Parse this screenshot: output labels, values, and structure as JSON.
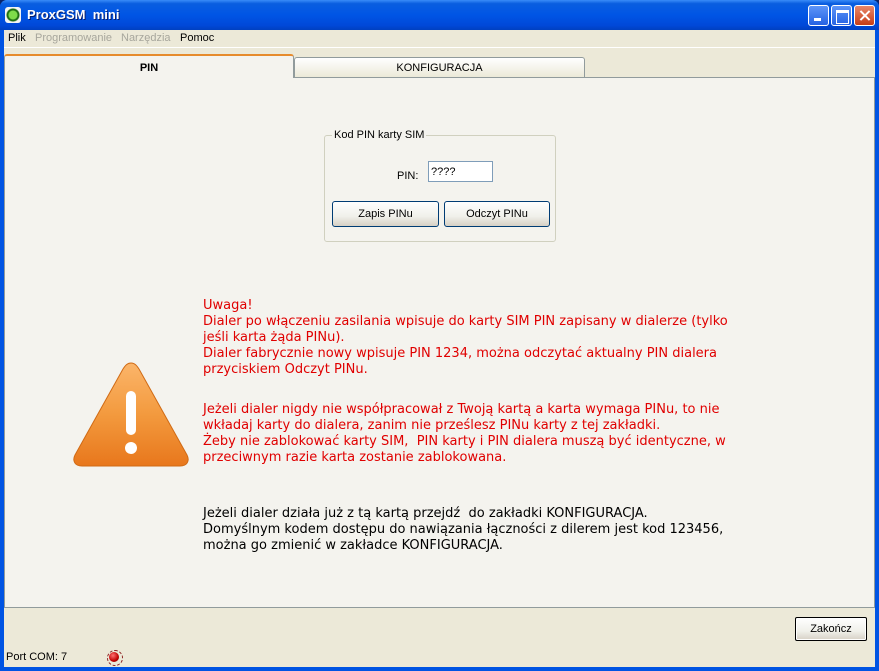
{
  "window": {
    "title": "ProxGSM  mini"
  },
  "menu": {
    "items": [
      {
        "label": "Plik",
        "disabled": false
      },
      {
        "label": "Programowanie",
        "disabled": true
      },
      {
        "label": "Narzędzia",
        "disabled": true
      },
      {
        "label": "Pomoc",
        "disabled": false
      }
    ]
  },
  "tabs": [
    {
      "label": "PIN",
      "active": true
    },
    {
      "label": "KONFIGURACJA",
      "active": false
    }
  ],
  "pin_group": {
    "legend": "Kod PIN karty SIM",
    "pin_label": "PIN:",
    "pin_value": "????",
    "save_button": "Zapis PINu",
    "read_button": "Odczyt PINu"
  },
  "warning": {
    "icon": "warning-triangle-icon",
    "color": "#e00000",
    "block1": "Uwaga!\nDialer po włączeniu zasilania wpisuje do karty SIM PIN zapisany w dialerze (tylko\njeśli karta żąda PINu).\nDialer fabrycznie nowy wpisuje PIN 1234, można odczytać aktualny PIN dialera\nprzyciskiem Odczyt PINu.",
    "block2": "Jeżeli dialer nigdy nie współpracował z Twoją kartą a karta wymaga PINu, to nie\nwkładaj karty do dialera, zanim nie prześlesz PINu karty z tej zakładki.\nŻeby nie zablokować karty SIM,  PIN karty i PIN dialera muszą być identyczne, w\nprzeciwnym razie karta zostanie zablokowana.",
    "block3": "Jeżeli dialer działa już z tą kartą przejdź  do zakładki KONFIGURACJA.\nDomyślnym kodem dostępu do nawiązania łączności z dilerem jest kod 123456,\nmożna go zmienić w zakładce KONFIGURACJA."
  },
  "footer": {
    "close_button": "Zakończ"
  },
  "statusbar": {
    "port": "Port COM: 7",
    "led_color": "#c00000"
  }
}
